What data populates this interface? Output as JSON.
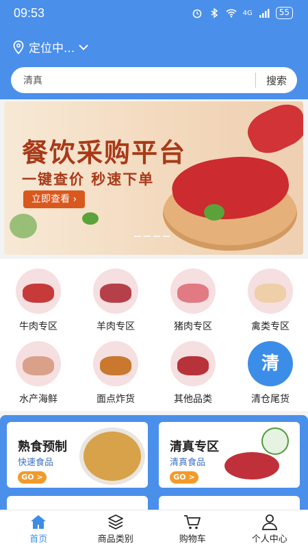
{
  "statusbar": {
    "time": "09:53",
    "battery": "55",
    "network": "4G"
  },
  "header": {
    "location": "定位中...",
    "search_placeholder": "清真",
    "search_button": "搜索"
  },
  "banner": {
    "title": "餐饮采购平台",
    "subtitle": "一键查价 秒速下单",
    "cta": "立即查看 ›"
  },
  "categories": [
    {
      "label": "牛肉专区",
      "color": "#c73a3a"
    },
    {
      "label": "羊肉专区",
      "color": "#b5404a"
    },
    {
      "label": "猪肉专区",
      "color": "#e27a84"
    },
    {
      "label": "禽类专区",
      "color": "#eecfa8"
    },
    {
      "label": "水产海鲜",
      "color": "#d9a18a"
    },
    {
      "label": "面点炸货",
      "color": "#c9782e"
    },
    {
      "label": "其他品类",
      "color": "#b8323a"
    },
    {
      "label": "清仓尾货",
      "badge": "清"
    }
  ],
  "promo": [
    {
      "title": "熟食预制",
      "sub": "快速食品",
      "go": "GO >"
    },
    {
      "title": "清真专区",
      "sub": "清真食品",
      "go": "GO >"
    }
  ],
  "bottomnav": [
    {
      "label": "首页",
      "icon": "home-icon",
      "active": true
    },
    {
      "label": "商品类别",
      "icon": "layers-icon"
    },
    {
      "label": "购物车",
      "icon": "cart-icon"
    },
    {
      "label": "个人中心",
      "icon": "user-icon"
    }
  ],
  "colors": {
    "primary": "#4a8fea",
    "accent": "#3c8de8",
    "banner_red": "#a83a18",
    "go_orange": "#f29b2a"
  }
}
